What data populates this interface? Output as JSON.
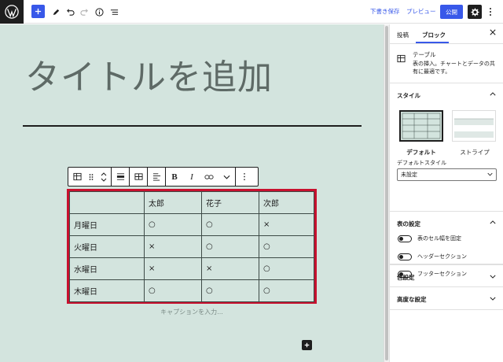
{
  "topbar": {
    "save_draft": "下書き保存",
    "preview": "プレビュー",
    "publish": "公開"
  },
  "editor": {
    "title_placeholder": "タイトルを追加",
    "caption_placeholder": "キャプションを入力..."
  },
  "table": {
    "header": [
      "",
      "太郎",
      "花子",
      "次郎"
    ],
    "rows": [
      [
        "月曜日",
        "○",
        "○",
        "×"
      ],
      [
        "火曜日",
        "×",
        "○",
        "○"
      ],
      [
        "水曜日",
        "×",
        "×",
        "○"
      ],
      [
        "木曜日",
        "○",
        "○",
        "○"
      ]
    ]
  },
  "sidebar": {
    "tabs": {
      "post": "投稿",
      "block": "ブロック"
    },
    "block": {
      "name": "テーブル",
      "description": "表の挿入。チャートとデータの共有に最適です。"
    },
    "styles": {
      "title": "スタイル",
      "default_label": "デフォルト",
      "stripe_label": "ストライプ",
      "default_style_label": "デフォルトスタイル",
      "default_style_value": "未設定"
    },
    "table_settings": {
      "title": "表の設定",
      "fixed_width": "表のセル幅を固定",
      "header_section": "ヘッダーセクション",
      "footer_section": "フッターセクション"
    },
    "color_settings": {
      "title": "色設定"
    },
    "advanced": {
      "title": "高度な設定"
    }
  },
  "colors": {
    "accent": "#3858e9",
    "canvas_bg": "#d3e4de",
    "highlight_border": "#c8102e"
  }
}
